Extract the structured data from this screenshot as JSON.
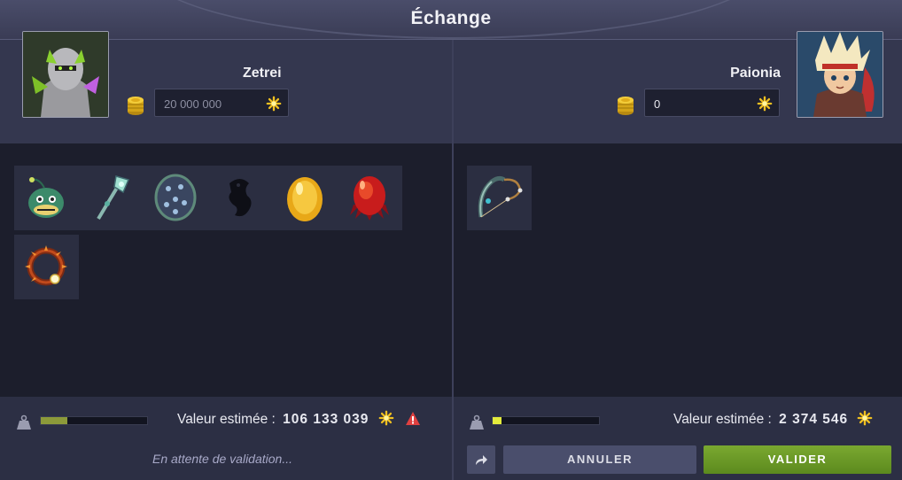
{
  "window": {
    "title": "Échange"
  },
  "left": {
    "player_name": "Zetrei",
    "kamas_value": "20 000 000",
    "estimated_label": "Valeur estimée :",
    "estimated_value": "106 133 039",
    "status": "En attente de validation...",
    "weight_fraction": 0.25,
    "items": [
      {
        "icon": "angler-fish-pet-icon"
      },
      {
        "icon": "crystal-staff-icon"
      },
      {
        "icon": "studded-shield-icon"
      },
      {
        "icon": "shadow-creature-icon"
      },
      {
        "icon": "golden-egg-icon"
      },
      {
        "icon": "red-dragon-egg-icon"
      },
      {
        "icon": "spiked-ring-icon"
      }
    ]
  },
  "right": {
    "player_name": "Paionia",
    "kamas_value": "0",
    "estimated_label": "Valeur estimée :",
    "estimated_value": "2 374 546",
    "weight_fraction": 0.08,
    "items": [
      {
        "icon": "bow-icon"
      }
    ]
  },
  "buttons": {
    "cancel": "ANNULER",
    "validate": "VALIDER"
  },
  "colors": {
    "validate": "#6c9a26",
    "warning": "#e04040",
    "kamas": "#e6c830"
  }
}
